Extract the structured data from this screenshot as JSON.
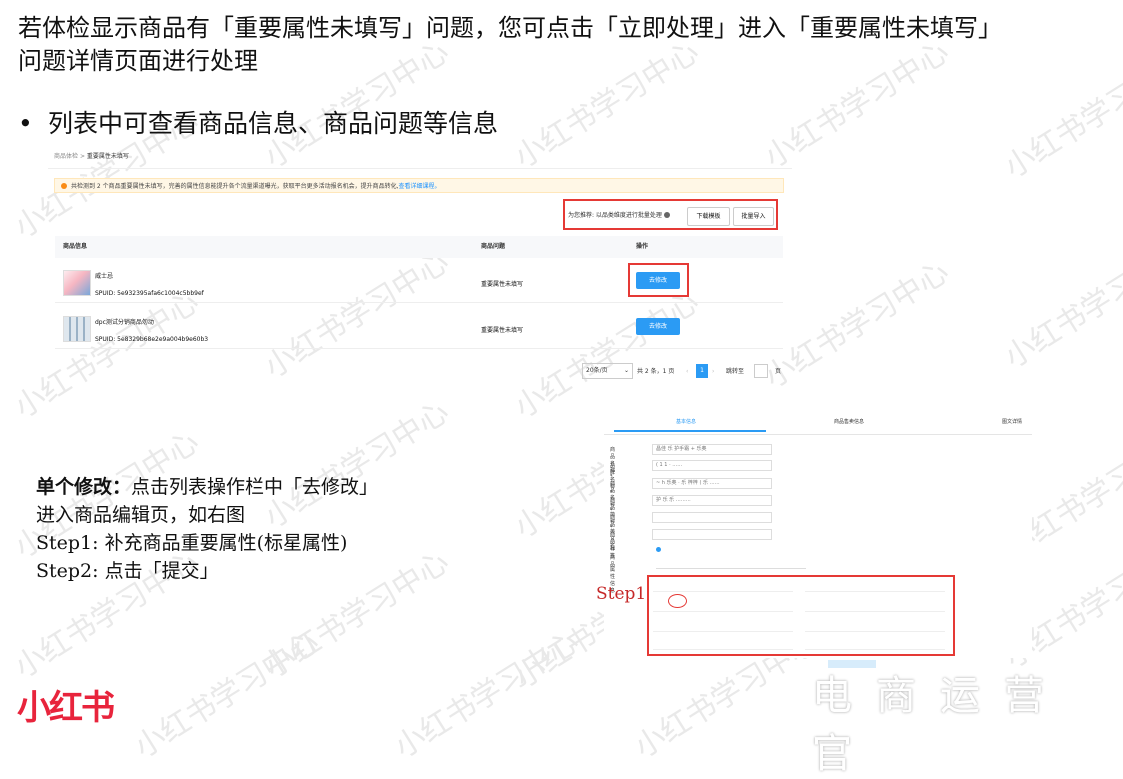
{
  "watermark": "小红书学习中心",
  "intro": {
    "line1": "若体检显示商品有「重要属性未填写」问题，您可点击「立即处理」进入「重要属性未填写」",
    "line2": "问题详情页面进行处理"
  },
  "bullet": {
    "symbol": "•",
    "text": "列表中可查看商品信息、商品问题等信息"
  },
  "list_screenshot": {
    "breadcrumb": {
      "parent": "商品体检",
      "sep": ">",
      "current": "重要属性未填写"
    },
    "notice": {
      "text": "共检测到 2 个商品重要属性未填写，完善的属性信息能提升各个流量渠道曝光，获取平台更多活动报名机会，提升商品转化,",
      "link": "查看详细课程。"
    },
    "toolbar": {
      "hint": "为您推荐: 以品类维度进行批量处理",
      "download_button": "下载模板",
      "import_button": "批量导入"
    },
    "columns": {
      "info": "商品信息",
      "issue": "商品问题",
      "action": "操作"
    },
    "rows": [
      {
        "name": "威士忌",
        "spuid": "SPUID: 5e932395afa6c1004c5bb9ef",
        "issue": "重要属性未填写",
        "action": "去修改"
      },
      {
        "name": "dpc测试分销商品勿动",
        "spuid": "SPUID: 5e8329b68e2e9a004b9e60b3",
        "issue": "重要属性未填写",
        "action": "去修改"
      }
    ],
    "pager": {
      "page_size": "20条/页",
      "summary": "共 2 条，1 页",
      "current": "1",
      "jump_label": "跳转至",
      "page_unit": "页"
    }
  },
  "single_edit": {
    "title": "单个修改",
    "colon": "：",
    "title_rest": "点击列表操作栏中「去修改」",
    "line2": "进入商品编辑页，如右图",
    "step1": "Step1:  补充商品重要属性(标星属性)",
    "step2": "Step2:  点击「提交」"
  },
  "edit_screenshot": {
    "tabs": [
      "基本信息",
      "商品售卖信息",
      "图文详情"
    ],
    "fields": [
      {
        "label": "商品名称 *",
        "value": "昌佳 乐 护手霜 + 乐奥"
      },
      {
        "label": "品牌名称 *",
        "value": "( 1 1 · ……"
      },
      {
        "label": "商品名称 *",
        "value": "~ h 乐奥 · 乐 梓梓 ( 乐 ……"
      },
      {
        "label": "商品简称 *",
        "value": "护 乐 乐 ………"
      },
      {
        "label": "商品英文名",
        "value": ""
      },
      {
        "label": "商品标签",
        "value": ""
      },
      {
        "label": "**商品",
        "value": ""
      },
      {
        "label": "属性信息",
        "value": ""
      }
    ],
    "step_label": "Step1"
  },
  "footer": {
    "logo": "小红书",
    "brand": "电商运营官"
  },
  "colors": {
    "accent_red": "#e53935",
    "button_blue": "#2b9bf4",
    "logo_red": "#e8243c"
  }
}
